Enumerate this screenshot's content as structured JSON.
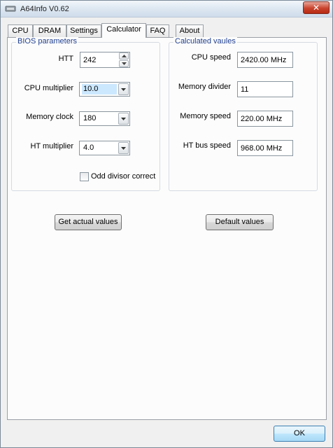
{
  "window": {
    "title": "A64Info V0.62",
    "close_label": "✕"
  },
  "tabs": [
    {
      "label": "CPU"
    },
    {
      "label": "DRAM"
    },
    {
      "label": "Settings"
    },
    {
      "label": "Calculator",
      "active": true
    },
    {
      "label": "FAQ"
    },
    {
      "label": "About"
    }
  ],
  "bios": {
    "title": "BIOS parameters",
    "htt": {
      "label": "HTT",
      "value": "242"
    },
    "cpu_multiplier": {
      "label": "CPU multiplier",
      "value": "10.0"
    },
    "memory_clock": {
      "label": "Memory clock",
      "value": "180"
    },
    "ht_multiplier": {
      "label": "HT multiplier",
      "value": "4.0"
    },
    "odd_divisor": {
      "label": "Odd divisor correct",
      "checked": false
    }
  },
  "calculated": {
    "title": "Calculated vaules",
    "cpu_speed": {
      "label": "CPU speed",
      "value": "2420.00 MHz"
    },
    "memory_divider": {
      "label": "Memory divider",
      "value": "11"
    },
    "memory_speed": {
      "label": "Memory speed",
      "value": "220.00 MHz"
    },
    "ht_bus_speed": {
      "label": "HT bus speed",
      "value": "968.00 MHz"
    }
  },
  "buttons": {
    "get_actual": "Get actual values",
    "default_values": "Default values",
    "ok": "OK"
  },
  "colors": {
    "group_title": "#1f3f8f",
    "selection": "#cce8ff",
    "close": "#c9432d"
  },
  "icons": [
    "app-icon",
    "close-icon",
    "spin-up-icon",
    "spin-down-icon",
    "dropdown-arrow-icon"
  ]
}
